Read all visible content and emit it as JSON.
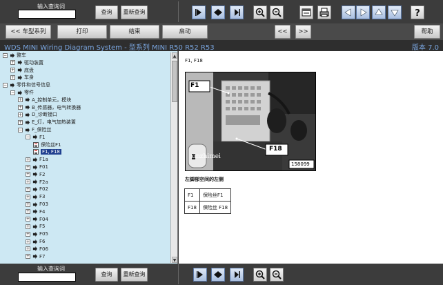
{
  "search": {
    "label": "输入查询词",
    "value": "",
    "search_button": "查询",
    "reset_button": "重新查询"
  },
  "toolbar_icons": [
    "first-page-icon",
    "previous-page-icon",
    "next-page-icon",
    "zoom-in-icon",
    "zoom-out-icon",
    "window-icon",
    "print-icon",
    "arrow-left-icon",
    "arrow-right-icon",
    "arrow-up-icon",
    "arrow-down-icon",
    "help-icon"
  ],
  "nav": {
    "back": "<< 车型系列",
    "print": "打印",
    "end": "结束",
    "start": "启动",
    "prev": "<<",
    "next": ">>",
    "help": "帮助"
  },
  "title": {
    "app": "WDS MINI Wiring Diagram System - 型系列  MINI R50 R52 R53",
    "version": "版本 7.0"
  },
  "tree": {
    "rows": [
      {
        "label": "整车",
        "toggle": "⊟",
        "icon": "arrow"
      },
      {
        "label": "驱动装置",
        "toggle": "⊞",
        "icon": "arrow"
      },
      {
        "label": "底盘",
        "toggle": "⊞",
        "icon": "arrow"
      },
      {
        "label": "车身",
        "toggle": "⊞",
        "icon": "arrow"
      },
      {
        "label": "零件和信号信息",
        "toggle": "⊟",
        "icon": "arrow"
      },
      {
        "label": "零件",
        "toggle": "⊟",
        "icon": "arrow"
      },
      {
        "label": "A_控制单元，模块",
        "toggle": "⊞",
        "icon": "arrow"
      },
      {
        "label": "B_传感器，电气转换器",
        "toggle": "⊞",
        "icon": "arrow"
      },
      {
        "label": "D_诊断接口",
        "toggle": "⊞",
        "icon": "arrow"
      },
      {
        "label": "E_灯，电气加热装置",
        "toggle": "⊞",
        "icon": "arrow"
      },
      {
        "label": "F_保险丝",
        "toggle": "⊟",
        "icon": "arrow"
      },
      {
        "label": "F1",
        "toggle": "⊟",
        "icon": "arrow"
      },
      {
        "label": "保险丝F1",
        "toggle": "",
        "icon": "doc"
      },
      {
        "label": "F1, F18",
        "toggle": "",
        "icon": "doc",
        "selected": true
      },
      {
        "label": "F1a",
        "toggle": "⊞",
        "icon": "arrow"
      },
      {
        "label": "F01",
        "toggle": "⊞",
        "icon": "arrow"
      },
      {
        "label": "F2",
        "toggle": "⊞",
        "icon": "arrow"
      },
      {
        "label": "F2a",
        "toggle": "⊞",
        "icon": "arrow"
      },
      {
        "label": "F02",
        "toggle": "⊞",
        "icon": "arrow"
      },
      {
        "label": "F3",
        "toggle": "⊞",
        "icon": "arrow"
      },
      {
        "label": "F03",
        "toggle": "⊞",
        "icon": "arrow"
      },
      {
        "label": "F4",
        "toggle": "⊞",
        "icon": "arrow"
      },
      {
        "label": "F04",
        "toggle": "⊞",
        "icon": "arrow"
      },
      {
        "label": "F5",
        "toggle": "⊞",
        "icon": "arrow"
      },
      {
        "label": "F05",
        "toggle": "⊞",
        "icon": "arrow"
      },
      {
        "label": "F6",
        "toggle": "⊞",
        "icon": "arrow"
      },
      {
        "label": "F06",
        "toggle": "⊞",
        "icon": "arrow"
      },
      {
        "label": "F7",
        "toggle": "⊞",
        "icon": "arrow"
      }
    ]
  },
  "content": {
    "heading": "F1, F18",
    "photo": {
      "label_f1": "F1",
      "label_f18": "F18",
      "photo_number": "158099",
      "watermark": "xinzhimei"
    },
    "caption": "左脚部空间的左侧",
    "table": [
      {
        "code": "F1",
        "desc": "保险丝F1"
      },
      {
        "code": "F18",
        "desc": "保险丝 F18"
      }
    ]
  },
  "colors": {
    "tree_bg": "#cde8f3",
    "title_text": "#7aa6e0",
    "selected_bg": "#1f3f8f",
    "toolbar_bg": "#3c3c3c"
  }
}
